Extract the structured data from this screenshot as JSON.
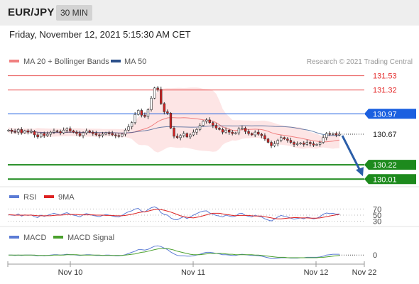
{
  "header": {
    "pair": "EUR/JPY",
    "timeframe": "30 MIN",
    "datetime": "Friday, November 12, 2021 5:15:30 AM CET"
  },
  "colors": {
    "ma20": "#f08080",
    "ma50": "#2b4f8a",
    "band_fill": "#fde0e0",
    "up_candle": "#ffffff",
    "down_candle": "#d32020",
    "resistance": "#e53030",
    "pivot": "#1a5fe0",
    "support": "#1d8a1d",
    "arrow": "#2b5ea8",
    "rsi": "#5b7bd5",
    "rsi_ma": "#dd2222",
    "macd": "#5b7bd5",
    "macd_signal": "#4aa02c"
  },
  "chart_data": [
    {
      "type": "candlestick",
      "title": "",
      "legend": [
        {
          "label": "MA 20 + Bollinger Bands",
          "color": "#f08080"
        },
        {
          "label": "MA 50",
          "color": "#2b4f8a"
        }
      ],
      "watermark": "Research © 2021 Trading Central",
      "x_ticks": [
        "Nov 10",
        "Nov 11",
        "Nov 12",
        "Nov 22"
      ],
      "ylim": [
        129.95,
        131.62
      ],
      "grid": false,
      "ohlc_close": [
        130.73,
        130.71,
        130.7,
        130.74,
        130.69,
        130.72,
        130.7,
        130.71,
        130.66,
        130.63,
        130.68,
        130.65,
        130.67,
        130.7,
        130.72,
        130.71,
        130.69,
        130.73,
        130.75,
        130.72,
        130.7,
        130.68,
        130.65,
        130.69,
        130.72,
        130.7,
        130.68,
        130.66,
        130.65,
        130.67,
        130.69,
        130.68,
        130.66,
        130.65,
        130.64,
        130.67,
        130.73,
        130.78,
        130.84,
        130.96,
        131.02,
        130.95,
        130.93,
        131.03,
        131.2,
        131.35,
        131.33,
        131.12,
        131.0,
        130.98,
        130.76,
        130.64,
        130.62,
        130.65,
        130.68,
        130.63,
        130.66,
        130.7,
        130.74,
        130.8,
        130.86,
        130.88,
        130.84,
        130.8,
        130.76,
        130.74,
        130.7,
        130.73,
        130.7,
        130.68,
        130.69,
        130.75,
        130.76,
        130.71,
        130.68,
        130.66,
        130.7,
        130.67,
        130.65,
        130.6,
        130.55,
        130.5,
        130.53,
        130.58,
        130.62,
        130.6,
        130.58,
        130.55,
        130.52,
        130.53,
        130.54,
        130.52,
        130.55,
        130.53,
        130.51,
        130.52,
        130.55,
        130.62,
        130.68,
        130.67,
        130.68,
        130.66,
        130.67
      ],
      "levels": [
        {
          "value": "131.53",
          "kind": "resistance"
        },
        {
          "value": "131.32",
          "kind": "resistance"
        },
        {
          "value": "130.97",
          "kind": "pivot"
        },
        {
          "value": "130.67",
          "kind": "last"
        },
        {
          "value": "130.22",
          "kind": "support"
        },
        {
          "value": "130.01",
          "kind": "support"
        }
      ],
      "forecast_arrow": {
        "from": 130.67,
        "to": 130.01
      }
    },
    {
      "type": "line",
      "title": "",
      "legend": [
        {
          "label": "RSI",
          "color": "#5b7bd5"
        },
        {
          "label": "9MA",
          "color": "#dd2222"
        }
      ],
      "y_ticks": [
        "70",
        "50",
        "30"
      ],
      "ylim": [
        20,
        80
      ],
      "series": [
        {
          "name": "RSI",
          "values": [
            52,
            50,
            49,
            54,
            47,
            51,
            49,
            51,
            45,
            42,
            50,
            46,
            49,
            53,
            56,
            53,
            50,
            55,
            58,
            53,
            50,
            48,
            44,
            51,
            55,
            52,
            49,
            47,
            45,
            49,
            52,
            50,
            47,
            45,
            44,
            49,
            56,
            61,
            64,
            70,
            72,
            63,
            60,
            68,
            74,
            77,
            72,
            58,
            52,
            50,
            41,
            36,
            35,
            40,
            45,
            39,
            44,
            50,
            55,
            60,
            63,
            64,
            57,
            53,
            49,
            47,
            44,
            50,
            47,
            45,
            47,
            55,
            56,
            49,
            46,
            44,
            50,
            46,
            44,
            38,
            34,
            31,
            37,
            44,
            49,
            46,
            44,
            40,
            37,
            39,
            41,
            38,
            43,
            41,
            38,
            40,
            45,
            53,
            57,
            55,
            56,
            53,
            54
          ]
        },
        {
          "name": "9MA",
          "values": [
            51,
            51,
            50,
            50,
            50,
            50,
            50,
            50,
            49,
            48,
            48,
            48,
            48,
            48,
            49,
            50,
            50,
            51,
            52,
            52,
            52,
            52,
            51,
            51,
            51,
            51,
            51,
            50,
            50,
            50,
            49,
            49,
            49,
            48,
            48,
            48,
            49,
            51,
            53,
            55,
            58,
            60,
            61,
            63,
            66,
            68,
            69,
            68,
            66,
            63,
            60,
            56,
            52,
            48,
            45,
            43,
            42,
            41,
            43,
            45,
            48,
            51,
            54,
            56,
            56,
            56,
            54,
            52,
            51,
            49,
            48,
            49,
            49,
            49,
            49,
            48,
            47,
            47,
            47,
            45,
            43,
            41,
            39,
            38,
            38,
            39,
            40,
            41,
            42,
            42,
            41,
            41,
            41,
            40,
            40,
            40,
            41,
            43,
            45,
            47,
            49,
            51,
            52
          ]
        }
      ]
    },
    {
      "type": "line",
      "title": "",
      "legend": [
        {
          "label": "MACD",
          "color": "#5b7bd5"
        },
        {
          "label": "MACD Signal",
          "color": "#4aa02c"
        }
      ],
      "y_ticks": [
        "0"
      ],
      "ylim": [
        -0.2,
        0.3
      ],
      "series": [
        {
          "name": "MACD",
          "values": [
            0.0,
            0.0,
            -0.01,
            0.0,
            -0.01,
            0.0,
            0.0,
            0.0,
            -0.01,
            -0.02,
            -0.01,
            -0.02,
            -0.01,
            0.0,
            0.01,
            0.01,
            0.0,
            0.01,
            0.02,
            0.01,
            0.01,
            0.0,
            -0.01,
            0.0,
            0.01,
            0.01,
            0.0,
            -0.01,
            -0.01,
            -0.01,
            0.0,
            0.0,
            -0.01,
            -0.02,
            -0.02,
            -0.01,
            0.01,
            0.04,
            0.07,
            0.1,
            0.14,
            0.14,
            0.13,
            0.15,
            0.19,
            0.23,
            0.24,
            0.22,
            0.18,
            0.14,
            0.08,
            0.03,
            -0.01,
            -0.02,
            -0.02,
            -0.03,
            -0.03,
            -0.02,
            0.0,
            0.02,
            0.05,
            0.07,
            0.07,
            0.06,
            0.04,
            0.03,
            0.01,
            0.01,
            0.0,
            -0.01,
            -0.01,
            0.01,
            0.02,
            0.01,
            0.0,
            -0.01,
            -0.01,
            -0.02,
            -0.03,
            -0.05,
            -0.07,
            -0.09,
            -0.09,
            -0.08,
            -0.07,
            -0.07,
            -0.07,
            -0.08,
            -0.08,
            -0.08,
            -0.07,
            -0.07,
            -0.06,
            -0.06,
            -0.06,
            -0.06,
            -0.05,
            -0.03,
            0.0,
            0.01,
            0.02,
            0.02,
            0.02
          ]
        },
        {
          "name": "MACD Signal",
          "values": [
            0.0,
            0.0,
            0.0,
            0.0,
            0.0,
            0.0,
            0.0,
            0.0,
            0.0,
            -0.01,
            -0.01,
            -0.01,
            -0.01,
            -0.01,
            0.0,
            0.0,
            0.0,
            0.0,
            0.01,
            0.01,
            0.01,
            0.01,
            0.0,
            0.0,
            0.0,
            0.0,
            0.0,
            0.0,
            0.0,
            -0.01,
            -0.01,
            -0.01,
            -0.01,
            -0.01,
            -0.01,
            -0.01,
            0.0,
            0.01,
            0.02,
            0.03,
            0.05,
            0.07,
            0.08,
            0.1,
            0.12,
            0.14,
            0.16,
            0.17,
            0.17,
            0.17,
            0.15,
            0.13,
            0.1,
            0.08,
            0.06,
            0.04,
            0.02,
            0.01,
            0.01,
            0.01,
            0.02,
            0.03,
            0.04,
            0.04,
            0.04,
            0.04,
            0.04,
            0.03,
            0.02,
            0.02,
            0.01,
            0.01,
            0.01,
            0.01,
            0.01,
            0.01,
            0.0,
            0.0,
            -0.01,
            -0.02,
            -0.03,
            -0.04,
            -0.05,
            -0.06,
            -0.06,
            -0.06,
            -0.07,
            -0.07,
            -0.07,
            -0.07,
            -0.07,
            -0.07,
            -0.07,
            -0.07,
            -0.07,
            -0.07,
            -0.06,
            -0.06,
            -0.05,
            -0.04,
            -0.03,
            -0.02,
            -0.01
          ]
        }
      ]
    }
  ]
}
